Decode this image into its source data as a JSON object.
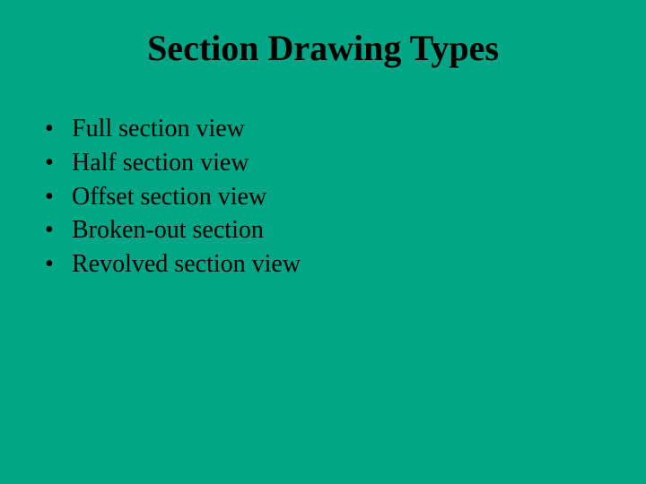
{
  "title": "Section Drawing Types",
  "bullets": [
    "Full section view",
    "Half section view",
    "Offset section view",
    "Broken-out section",
    "Revolved section view"
  ]
}
